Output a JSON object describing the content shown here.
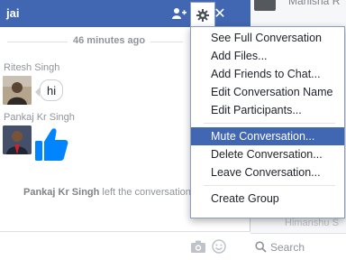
{
  "chat": {
    "title": "jai",
    "time_divider": "46 minutes ago",
    "messages": [
      {
        "sender": "Ritesh Singh",
        "text": "hi"
      },
      {
        "sender": "Pankaj Kr Singh",
        "sticker": "thumbs-up-icon"
      }
    ],
    "left_notice": {
      "name": "Pankaj Kr Singh",
      "text": "left the conversation"
    }
  },
  "menu": {
    "group1": [
      "See Full Conversation",
      "Add Files...",
      "Add Friends to Chat...",
      "Edit Conversation Name",
      "Edit Participants..."
    ],
    "group2": [
      "Mute Conversation...",
      "Delete Conversation...",
      "Leave Conversation..."
    ],
    "group3": [
      "Create Group"
    ],
    "active_item": "Mute Conversation..."
  },
  "sidebar": {
    "top_contact": "Manisha R",
    "bottom_contact": "Himanshu S",
    "search_label": "Search"
  },
  "colors": {
    "header": "#4267b2",
    "highlight": "#4267b2",
    "thumb": "#0084ff"
  },
  "icons": [
    "add-friend-icon",
    "gear-icon",
    "close-icon",
    "camera-icon",
    "emoji-icon",
    "search-icon",
    "thumbs-up-icon"
  ]
}
